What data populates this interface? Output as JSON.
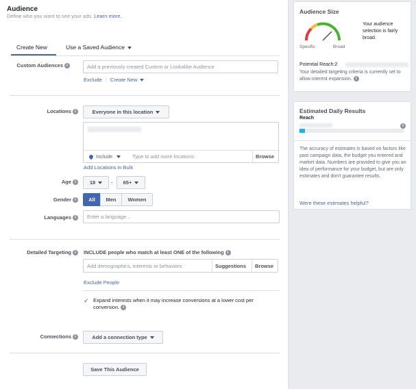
{
  "header": {
    "title": "Audience",
    "subtitle": "Define who you want to see your ads.",
    "learn_more": "Learn more."
  },
  "tabs": [
    "Create New",
    "Use a Saved Audience"
  ],
  "custom_audiences": {
    "label": "Custom Audiences",
    "placeholder": "Add a previously created Custom or Lookalike Audience",
    "exclude": "Exclude",
    "create_new": "Create New"
  },
  "locations": {
    "label": "Locations",
    "dropdown": "Everyone in this location",
    "include": "Include",
    "add_placeholder": "Type to add more locations",
    "browse": "Browse",
    "add_bulk": "Add Locations in Bulk"
  },
  "age": {
    "label": "Age",
    "min": "18",
    "separator": "-",
    "max": "65+"
  },
  "gender": {
    "label": "Gender",
    "options": [
      "All",
      "Men",
      "Women"
    ],
    "selected": "All"
  },
  "languages": {
    "label": "Languages",
    "placeholder": "Enter a language..."
  },
  "detailed_targeting": {
    "label": "Detailed Targeting",
    "include_text": "INCLUDE people who match at least ONE of the following",
    "placeholder": "Add demographics, interests or behaviors",
    "suggestions": "Suggestions",
    "browse": "Browse",
    "exclude_people": "Exclude People",
    "expand_text": "Expand interests when it may increase conversions at a lower cost per conversion."
  },
  "connections": {
    "label": "Connections",
    "dropdown": "Add a connection type"
  },
  "save_button": "Save This Audience",
  "audience_size": {
    "title": "Audience Size",
    "description": "Your audience selection is fairly broad.",
    "specific": "Specific",
    "broad": "Broad",
    "potential_reach": "Potential Reach:2",
    "criteria_text": "Your detailed targeting criteria is currently set to allow interest expansion.",
    "gauge_level": 0.75
  },
  "estimated_results": {
    "title": "Estimated Daily Results",
    "reach_label": "Reach",
    "disclaimer": "The accuracy of estimates is based on factors like past campaign data, the budget you entered and market data. Numbers are provided to give you an idea of performance for your budget, but are only estimates and don't guarantee results.",
    "helpful_link": "Were these estimates helpful?",
    "reach_bar_level": 0.05
  },
  "colors": {
    "accent": "#4267b2",
    "gauge_red": "#e0393e",
    "gauge_yellow": "#f7b928",
    "gauge_green": "#42b72a",
    "reach_bar": "#1bb5e5"
  }
}
